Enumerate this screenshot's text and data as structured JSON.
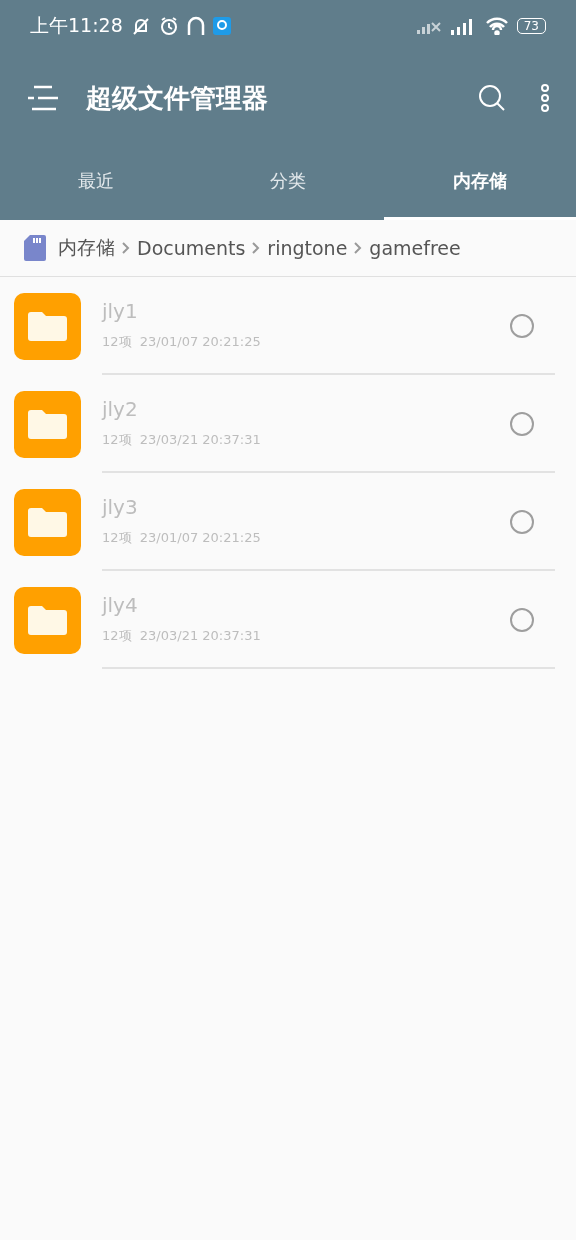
{
  "status_bar": {
    "time": "上午11:28",
    "battery": "73"
  },
  "app_bar": {
    "title": "超级文件管理器"
  },
  "tabs": [
    {
      "label": "最近",
      "selected": false
    },
    {
      "label": "分类",
      "selected": false
    },
    {
      "label": "内存储",
      "selected": true
    }
  ],
  "breadcrumb": [
    "内存储",
    "Documents",
    "ringtone",
    "gamefree"
  ],
  "folders": [
    {
      "name": "jly1",
      "count": "12项",
      "date": "23/01/07 20:21:25",
      "checked": false
    },
    {
      "name": "jly2",
      "count": "12项",
      "date": "23/03/21 20:37:31",
      "checked": false
    },
    {
      "name": "jly3",
      "count": "12项",
      "date": "23/01/07 20:21:25",
      "checked": false
    },
    {
      "name": "jly4",
      "count": "12项",
      "date": "23/03/21 20:37:31",
      "checked": false
    }
  ]
}
